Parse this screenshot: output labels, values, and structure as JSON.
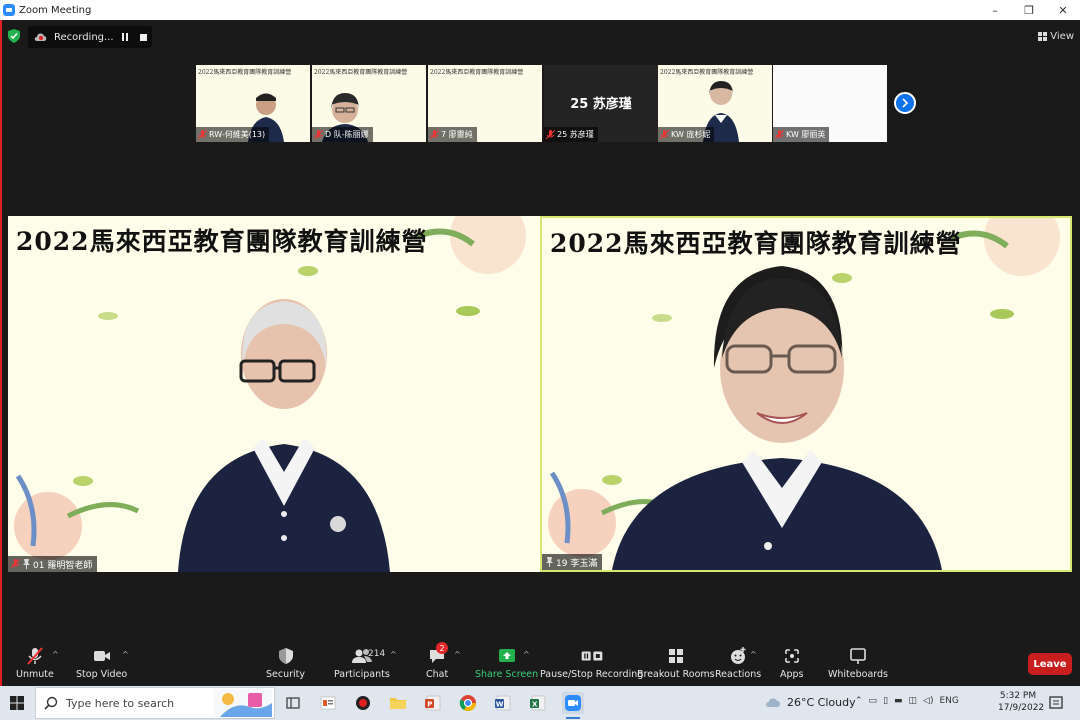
{
  "window": {
    "title": "Zoom Meeting",
    "minimize": "–",
    "maximize": "❐",
    "close": "✕"
  },
  "recording": {
    "label": "Recording..."
  },
  "view": {
    "label": "View"
  },
  "banner": {
    "title": "2022馬來西亞教育團隊教育訓練營"
  },
  "gallery": [
    {
      "name": "RW-何維美(13)",
      "type": "video"
    },
    {
      "name": "D 队-陈丽娜",
      "type": "video"
    },
    {
      "name": "7 廖靈純",
      "type": "video"
    },
    {
      "name": "25 苏彦瑾",
      "type": "text",
      "display": "25 苏彦瑾"
    },
    {
      "name": "KW 庞杉妮",
      "type": "video"
    },
    {
      "name": "KW 廖丽英",
      "type": "video"
    }
  ],
  "main_videos": [
    {
      "name": "01 羅明智老師"
    },
    {
      "name": "19 李玉滿"
    }
  ],
  "toolbar": {
    "unmute": "Unmute",
    "stop_video": "Stop Video",
    "security": "Security",
    "participants": "Participants",
    "participants_count": "214",
    "chat": "Chat",
    "chat_badge": "2",
    "share_screen": "Share Screen",
    "pause_stop_recording": "Pause/Stop Recording",
    "breakout_rooms": "Breakout Rooms",
    "reactions": "Reactions",
    "apps": "Apps",
    "whiteboards": "Whiteboards",
    "leave": "Leave"
  },
  "taskbar": {
    "search_placeholder": "Type here to search",
    "weather": "26°C  Cloudy",
    "language": "ENG",
    "time": "5:32 PM",
    "date": "17/9/2022"
  },
  "colors": {
    "accent": "#0e72ed",
    "leave": "#c81e1e",
    "share": "#3cd07a",
    "active_speaker_border": "#d6e86e"
  }
}
